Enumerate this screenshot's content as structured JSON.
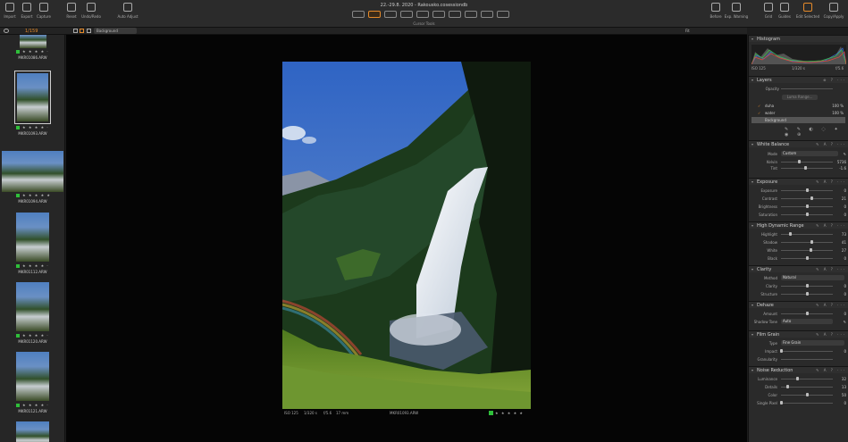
{
  "window": {
    "title": "22.-29.8. 2020 - Rakousko.cosessiondb"
  },
  "toolbar": {
    "left": [
      {
        "label": "Import",
        "icon": "import-icon"
      },
      {
        "label": "Export",
        "icon": "export-icon"
      },
      {
        "label": "Capture",
        "icon": "capture-icon"
      },
      {
        "label": "Reset",
        "icon": "reset-icon"
      },
      {
        "label": "Undo/Redo",
        "icon": "undo-redo-icon"
      },
      {
        "label": "Auto Adjust",
        "icon": "auto-adjust-icon"
      }
    ],
    "cursor_tools_label": "Cursor Tools",
    "right": [
      {
        "label": "Before",
        "icon": "before-icon"
      },
      {
        "label": "Exp. Warning",
        "icon": "exposure-warning-icon"
      },
      {
        "label": "Grid",
        "icon": "grid-icon"
      },
      {
        "label": "Guides",
        "icon": "guides-icon"
      },
      {
        "label": "Edit Selected",
        "icon": "edit-selected-icon"
      },
      {
        "label": "Copy/Apply",
        "icon": "copy-apply-icon"
      }
    ]
  },
  "subbar": {
    "count": "1/159",
    "layer_select": "Background",
    "fit": "Fit"
  },
  "browser": {
    "thumbnails": [
      {
        "name": "MKR01086.ARW",
        "stars": "★ ★ ★ ★ ·"
      },
      {
        "name": "MKR01093.ARW",
        "stars": "★ ★ ★ ★ ·",
        "selected": true
      },
      {
        "name": "MKR01094.ARW",
        "stars": "★ ★ ★ ★ ★"
      },
      {
        "name": "MKR01112.ARW",
        "stars": "★ ★ ★ ★ ·"
      },
      {
        "name": "MKR01120.ARW",
        "stars": "★ ★ ★ ★ ·"
      },
      {
        "name": "MKR01121.ARW",
        "stars": "★ ★ ★ ★ ·"
      }
    ]
  },
  "viewer": {
    "iso": "ISO 125",
    "shutter": "1/320 s",
    "aperture": "f/5.6",
    "focal": "17 mm",
    "filename": "MKR01093.ARW",
    "stars": "★ ★ ★ ★ ★"
  },
  "tools": {
    "histogram": {
      "title": "Histogram",
      "iso": "ISO 125",
      "shutter": "1/320 s",
      "aperture": "f/5.6"
    },
    "layers": {
      "title": "Layers",
      "opacity_label": "Opacity",
      "luma_range": "Luma Range...",
      "items": [
        {
          "name": "duha",
          "opacity": "100 %"
        },
        {
          "name": "water",
          "opacity": "100 %"
        },
        {
          "name": "Background",
          "opacity": ""
        }
      ]
    },
    "white_balance": {
      "title": "White Balance",
      "mode_label": "Mode",
      "mode_value": "Custom",
      "rows": [
        {
          "label": "Kelvin",
          "value": "5736",
          "pos": 0.35
        },
        {
          "label": "Tint",
          "value": "-1.6",
          "pos": 0.48
        }
      ]
    },
    "exposure": {
      "title": "Exposure",
      "rows": [
        {
          "label": "Exposure",
          "value": "0",
          "pos": 0.5
        },
        {
          "label": "Contrast",
          "value": "21",
          "pos": 0.6
        },
        {
          "label": "Brightness",
          "value": "0",
          "pos": 0.5
        },
        {
          "label": "Saturation",
          "value": "0",
          "pos": 0.5
        }
      ]
    },
    "hdr": {
      "title": "High Dynamic Range",
      "rows": [
        {
          "label": "Highlight",
          "value": "73",
          "pos": 0.18
        },
        {
          "label": "Shadow",
          "value": "41",
          "pos": 0.6
        },
        {
          "label": "White",
          "value": "27",
          "pos": 0.58
        },
        {
          "label": "Black",
          "value": "0",
          "pos": 0.5
        }
      ]
    },
    "clarity": {
      "title": "Clarity",
      "method_label": "Method",
      "method_value": "Natural",
      "rows": [
        {
          "label": "Clarity",
          "value": "0",
          "pos": 0.5
        },
        {
          "label": "Structure",
          "value": "0",
          "pos": 0.5
        }
      ]
    },
    "dehaze": {
      "title": "Dehaze",
      "rows": [
        {
          "label": "Amount",
          "value": "0",
          "pos": 0.5
        }
      ],
      "shadow_tone_label": "Shadow Tone",
      "shadow_tone_value": "Auto"
    },
    "film_grain": {
      "title": "Film Grain",
      "type_label": "Type",
      "type_value": "Fine Grain",
      "rows": [
        {
          "label": "Impact",
          "value": "0",
          "pos": 0.0
        },
        {
          "label": "Granularity",
          "value": "",
          "pos": null
        }
      ]
    },
    "noise_reduction": {
      "title": "Noise Reduction",
      "rows": [
        {
          "label": "Luminance",
          "value": "32",
          "pos": 0.32
        },
        {
          "label": "Details",
          "value": "13",
          "pos": 0.13
        },
        {
          "label": "Color",
          "value": "50",
          "pos": 0.5
        },
        {
          "label": "Single Pixel",
          "value": "0",
          "pos": 0.0
        }
      ]
    }
  },
  "colors": {
    "accent": "#e58a2a",
    "green_tag": "#2fbf3a"
  }
}
